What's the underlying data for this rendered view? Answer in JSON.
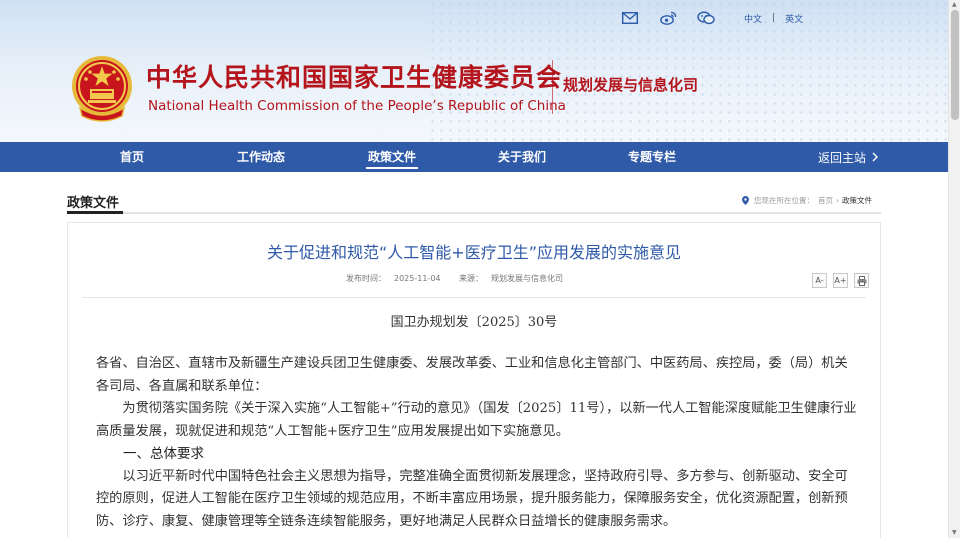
{
  "header": {
    "lang_cn": "中文",
    "lang_sep": "|",
    "lang_en": "英文",
    "title_cn": "中华人民共和国国家卫生健康委员会",
    "title_en": "National Health Commission of the People’s Republic of China",
    "dept": "规划发展与信息化司",
    "icons": [
      "mail-icon",
      "weibo-icon",
      "wechat-icon"
    ]
  },
  "nav": {
    "items": [
      "首页",
      "工作动态",
      "政策文件",
      "关于我们",
      "专题专栏"
    ],
    "active": "政策文件",
    "return_label": "返回主站"
  },
  "section": {
    "title": "政策文件",
    "breadcrumb_prefix": "您现在所在位置：",
    "breadcrumb_home": "首页",
    "breadcrumb_sep": "›",
    "breadcrumb_current": "政策文件"
  },
  "article": {
    "title": "关于促进和规范“人工智能+医疗卫生”应用发展的实施意见",
    "publish_time_label": "发布时间：",
    "publish_time": "2025-11-04",
    "source_label": "来源：",
    "source": "规划发展与信息化司",
    "tool_font_small": "A-",
    "tool_font_large": "A+",
    "doc_number": "国卫办规划发〔2025〕30号",
    "para_addressee": "各省、自治区、直辖市及新疆生产建设兵团卫生健康委、发展改革委、工业和信息化主管部门、中医药局、疾控局，委（局）机关各司局、各直属和联系单位：",
    "para_intro": "为贯彻落实国务院《关于深入实施“人工智能+”行动的意见》（国发〔2025〕11号），以新一代人工智能深度赋能卫生健康行业高质量发展，现就促进和规范“人工智能+医疗卫生”应用发展提出如下实施意见。",
    "heading_1": "一、总体要求",
    "para_1": "以习近平新时代中国特色社会主义思想为指导，完整准确全面贯彻新发展理念，坚持政府引导、多方参与、创新驱动、安全可控的原则，促进人工智能在医疗卫生领域的规范应用，不断丰富应用场景，提升服务能力，保障服务安全，优化资源配置，创新预防、诊疗、康复、健康管理等全链条连续智能服务，更好地满足人民群众日益增长的健康服务需求。"
  },
  "colors": {
    "nav_blue": "#2f5aa8",
    "brand_red": "#b4141b",
    "title_blue": "#2f5aa8"
  }
}
